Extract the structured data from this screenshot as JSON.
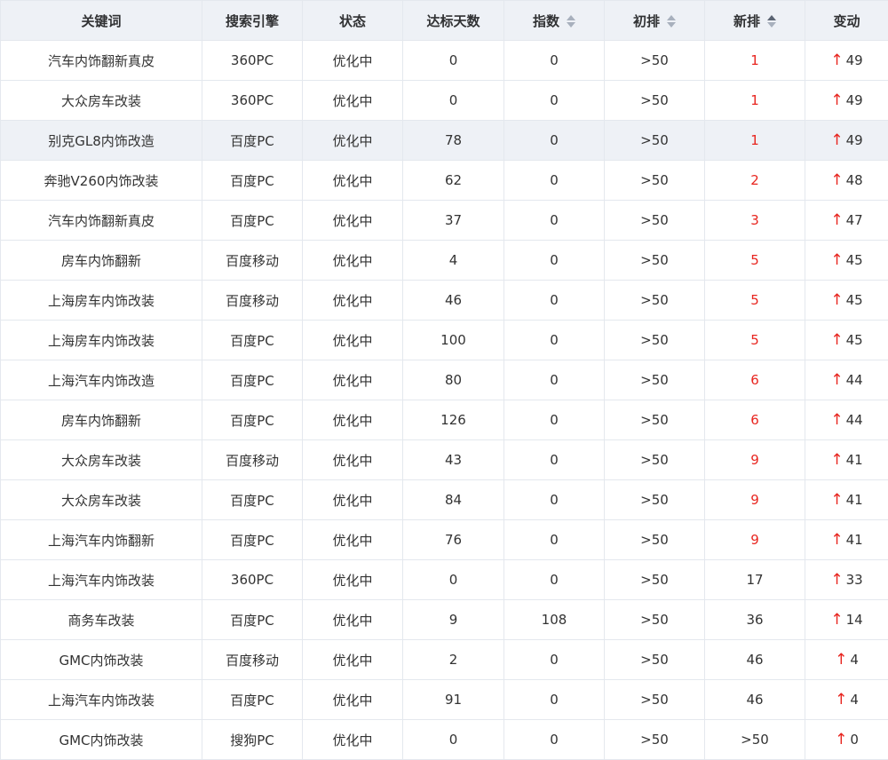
{
  "table": {
    "headers": {
      "keyword": "关键词",
      "engine": "搜索引擎",
      "status": "状态",
      "days": "达标天数",
      "index": "指数",
      "initial": "初排",
      "new": "新排",
      "change": "变动"
    },
    "colors": {
      "highlight_rank": "#e8251f",
      "up_arrow": "#e8251f",
      "header_bg": "#eef1f6"
    },
    "up_arrow_icon": "↑",
    "rows": [
      {
        "keyword": "汽车内饰翻新真皮",
        "engine": "360PC",
        "status": "优化中",
        "days": "0",
        "index": "0",
        "initial": ">50",
        "new": "1",
        "new_red": true,
        "change": "49"
      },
      {
        "keyword": "大众房车改装",
        "engine": "360PC",
        "status": "优化中",
        "days": "0",
        "index": "0",
        "initial": ">50",
        "new": "1",
        "new_red": true,
        "change": "49"
      },
      {
        "keyword": "别克GL8内饰改造",
        "engine": "百度PC",
        "status": "优化中",
        "days": "78",
        "index": "0",
        "initial": ">50",
        "new": "1",
        "new_red": true,
        "change": "49"
      },
      {
        "keyword": "奔驰V260内饰改装",
        "engine": "百度PC",
        "status": "优化中",
        "days": "62",
        "index": "0",
        "initial": ">50",
        "new": "2",
        "new_red": true,
        "change": "48"
      },
      {
        "keyword": "汽车内饰翻新真皮",
        "engine": "百度PC",
        "status": "优化中",
        "days": "37",
        "index": "0",
        "initial": ">50",
        "new": "3",
        "new_red": true,
        "change": "47"
      },
      {
        "keyword": "房车内饰翻新",
        "engine": "百度移动",
        "status": "优化中",
        "days": "4",
        "index": "0",
        "initial": ">50",
        "new": "5",
        "new_red": true,
        "change": "45"
      },
      {
        "keyword": "上海房车内饰改装",
        "engine": "百度移动",
        "status": "优化中",
        "days": "46",
        "index": "0",
        "initial": ">50",
        "new": "5",
        "new_red": true,
        "change": "45"
      },
      {
        "keyword": "上海房车内饰改装",
        "engine": "百度PC",
        "status": "优化中",
        "days": "100",
        "index": "0",
        "initial": ">50",
        "new": "5",
        "new_red": true,
        "change": "45"
      },
      {
        "keyword": "上海汽车内饰改造",
        "engine": "百度PC",
        "status": "优化中",
        "days": "80",
        "index": "0",
        "initial": ">50",
        "new": "6",
        "new_red": true,
        "change": "44"
      },
      {
        "keyword": "房车内饰翻新",
        "engine": "百度PC",
        "status": "优化中",
        "days": "126",
        "index": "0",
        "initial": ">50",
        "new": "6",
        "new_red": true,
        "change": "44"
      },
      {
        "keyword": "大众房车改装",
        "engine": "百度移动",
        "status": "优化中",
        "days": "43",
        "index": "0",
        "initial": ">50",
        "new": "9",
        "new_red": true,
        "change": "41"
      },
      {
        "keyword": "大众房车改装",
        "engine": "百度PC",
        "status": "优化中",
        "days": "84",
        "index": "0",
        "initial": ">50",
        "new": "9",
        "new_red": true,
        "change": "41"
      },
      {
        "keyword": "上海汽车内饰翻新",
        "engine": "百度PC",
        "status": "优化中",
        "days": "76",
        "index": "0",
        "initial": ">50",
        "new": "9",
        "new_red": true,
        "change": "41"
      },
      {
        "keyword": "上海汽车内饰改装",
        "engine": "360PC",
        "status": "优化中",
        "days": "0",
        "index": "0",
        "initial": ">50",
        "new": "17",
        "new_red": false,
        "change": "33"
      },
      {
        "keyword": "商务车改装",
        "engine": "百度PC",
        "status": "优化中",
        "days": "9",
        "index": "108",
        "initial": ">50",
        "new": "36",
        "new_red": false,
        "change": "14"
      },
      {
        "keyword": "GMC内饰改装",
        "engine": "百度移动",
        "status": "优化中",
        "days": "2",
        "index": "0",
        "initial": ">50",
        "new": "46",
        "new_red": false,
        "change": "4"
      },
      {
        "keyword": "上海汽车内饰改装",
        "engine": "百度PC",
        "status": "优化中",
        "days": "91",
        "index": "0",
        "initial": ">50",
        "new": "46",
        "new_red": false,
        "change": "4"
      },
      {
        "keyword": "GMC内饰改装",
        "engine": "搜狗PC",
        "status": "优化中",
        "days": "0",
        "index": "0",
        "initial": ">50",
        "new": ">50",
        "new_red": false,
        "change": "0"
      }
    ]
  }
}
